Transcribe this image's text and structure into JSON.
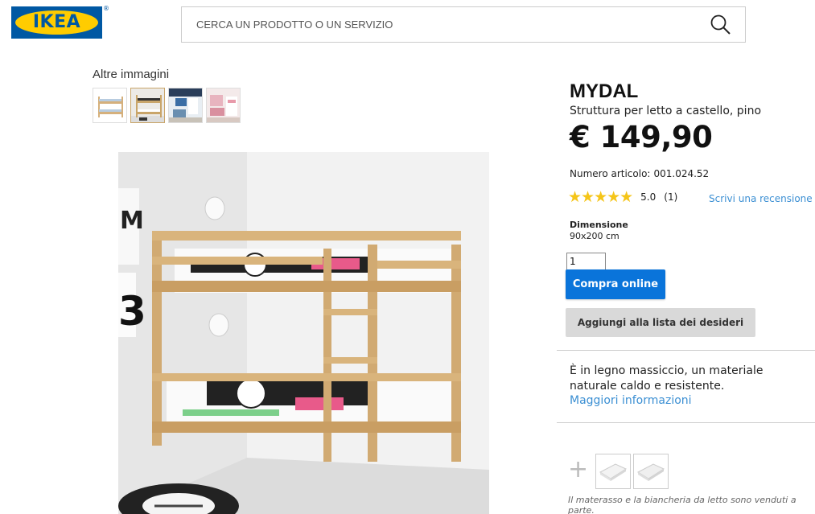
{
  "header": {
    "logo_text": "IKEA",
    "logo_reg": "®",
    "search_placeholder": "CERCA UN PRODOTTO O UN SERVIZIO",
    "search_icon": "magnifier-icon"
  },
  "gallery": {
    "label": "Altre immagini",
    "thumbnails": [
      {
        "name": "thumb-bunk-bed-white-bg"
      },
      {
        "name": "thumb-bunk-bed-room",
        "selected": true
      },
      {
        "name": "thumb-kids-room-blue"
      },
      {
        "name": "thumb-kids-room-pink"
      }
    ]
  },
  "product": {
    "name": "MYDAL",
    "description": "Struttura per letto a castello, pino",
    "price": "€ 149,90",
    "article_label": "Numero articolo:",
    "article_number": "001.024.52",
    "rating_stars": "★★★★★",
    "rating_score": "5.0",
    "rating_count": "(1)",
    "review_link": "Scrivi una recensione",
    "dimension_label": "Dimensione",
    "dimension_value": "90x200 cm",
    "quantity": "1",
    "buy_button": "Compra online",
    "wishlist_button": "Aggiungi alla lista dei desideri",
    "material_text": "È in legno massiccio, un materiale naturale caldo e resistente.",
    "more_info_link": "Maggiori informazioni",
    "accessories_plus": "+",
    "accessories_note": "Il materasso e la biancheria da letto sono venduti a parte."
  },
  "colors": {
    "brand_blue": "#0058a3",
    "brand_yellow": "#ffcc00",
    "buy_blue": "#0a74da",
    "link_blue": "#3b8fd3",
    "star_yellow": "#f5c518"
  }
}
